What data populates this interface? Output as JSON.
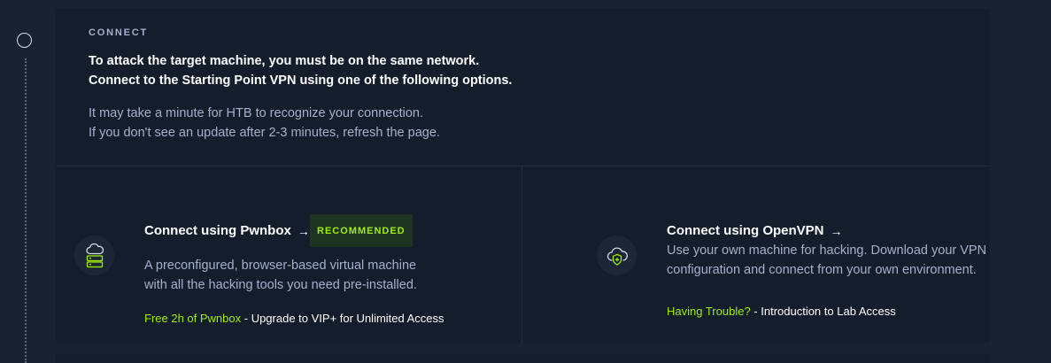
{
  "connect": {
    "eyebrow": "CONNECT",
    "lead_line1": "To attack the target machine, you must be on the same network.",
    "lead_line2": "Connect to the Starting Point VPN using one of the following options.",
    "note_line1": "It may take a minute for HTB to recognize your connection.",
    "note_line2": "If you don't see an update after 2-3 minutes, refresh the page."
  },
  "pwnbox": {
    "title": "Connect using Pwnbox",
    "arrow": "→",
    "badge": "RECOMMENDED",
    "desc_line1": "A preconfigured, browser-based virtual machine",
    "desc_line2": "with all the hacking tools you need pre-installed.",
    "foot_accent": "Free 2h of Pwnbox",
    "foot_sep": " - ",
    "foot_link": "Upgrade to VIP+ for Unlimited Access",
    "icon": "cloud-server-icon"
  },
  "openvpn": {
    "title": "Connect using OpenVPN",
    "arrow": "→",
    "desc_line1": "Use your own machine for hacking. Download your VPN",
    "desc_line2": "configuration and connect from your own environment.",
    "foot_accent": "Having Trouble?",
    "foot_sep": " - ",
    "foot_link": "Introduction to Lab Access",
    "icon": "cloud-shield-icon"
  },
  "colors": {
    "background": "#1a2130",
    "card": "#141d2b",
    "accent_green": "#9fef00",
    "text_muted": "#a4b1cd",
    "badge_bg": "#1f3322"
  }
}
